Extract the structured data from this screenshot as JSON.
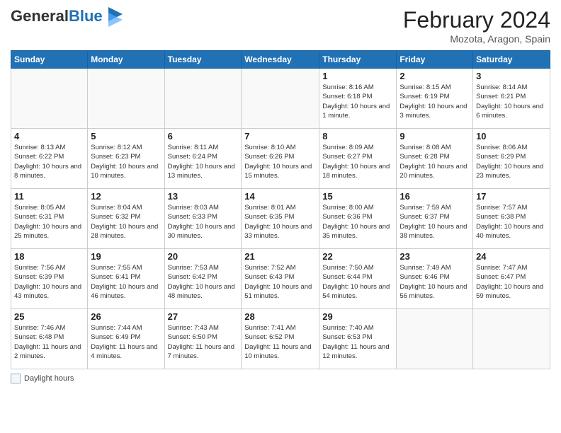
{
  "header": {
    "logo_general": "General",
    "logo_blue": "Blue",
    "month_title": "February 2024",
    "location": "Mozota, Aragon, Spain"
  },
  "days_of_week": [
    "Sunday",
    "Monday",
    "Tuesday",
    "Wednesday",
    "Thursday",
    "Friday",
    "Saturday"
  ],
  "weeks": [
    [
      {
        "day": "",
        "info": ""
      },
      {
        "day": "",
        "info": ""
      },
      {
        "day": "",
        "info": ""
      },
      {
        "day": "",
        "info": ""
      },
      {
        "day": "1",
        "info": "Sunrise: 8:16 AM\nSunset: 6:18 PM\nDaylight: 10 hours and 1 minute."
      },
      {
        "day": "2",
        "info": "Sunrise: 8:15 AM\nSunset: 6:19 PM\nDaylight: 10 hours and 3 minutes."
      },
      {
        "day": "3",
        "info": "Sunrise: 8:14 AM\nSunset: 6:21 PM\nDaylight: 10 hours and 6 minutes."
      }
    ],
    [
      {
        "day": "4",
        "info": "Sunrise: 8:13 AM\nSunset: 6:22 PM\nDaylight: 10 hours and 8 minutes."
      },
      {
        "day": "5",
        "info": "Sunrise: 8:12 AM\nSunset: 6:23 PM\nDaylight: 10 hours and 10 minutes."
      },
      {
        "day": "6",
        "info": "Sunrise: 8:11 AM\nSunset: 6:24 PM\nDaylight: 10 hours and 13 minutes."
      },
      {
        "day": "7",
        "info": "Sunrise: 8:10 AM\nSunset: 6:26 PM\nDaylight: 10 hours and 15 minutes."
      },
      {
        "day": "8",
        "info": "Sunrise: 8:09 AM\nSunset: 6:27 PM\nDaylight: 10 hours and 18 minutes."
      },
      {
        "day": "9",
        "info": "Sunrise: 8:08 AM\nSunset: 6:28 PM\nDaylight: 10 hours and 20 minutes."
      },
      {
        "day": "10",
        "info": "Sunrise: 8:06 AM\nSunset: 6:29 PM\nDaylight: 10 hours and 23 minutes."
      }
    ],
    [
      {
        "day": "11",
        "info": "Sunrise: 8:05 AM\nSunset: 6:31 PM\nDaylight: 10 hours and 25 minutes."
      },
      {
        "day": "12",
        "info": "Sunrise: 8:04 AM\nSunset: 6:32 PM\nDaylight: 10 hours and 28 minutes."
      },
      {
        "day": "13",
        "info": "Sunrise: 8:03 AM\nSunset: 6:33 PM\nDaylight: 10 hours and 30 minutes."
      },
      {
        "day": "14",
        "info": "Sunrise: 8:01 AM\nSunset: 6:35 PM\nDaylight: 10 hours and 33 minutes."
      },
      {
        "day": "15",
        "info": "Sunrise: 8:00 AM\nSunset: 6:36 PM\nDaylight: 10 hours and 35 minutes."
      },
      {
        "day": "16",
        "info": "Sunrise: 7:59 AM\nSunset: 6:37 PM\nDaylight: 10 hours and 38 minutes."
      },
      {
        "day": "17",
        "info": "Sunrise: 7:57 AM\nSunset: 6:38 PM\nDaylight: 10 hours and 40 minutes."
      }
    ],
    [
      {
        "day": "18",
        "info": "Sunrise: 7:56 AM\nSunset: 6:39 PM\nDaylight: 10 hours and 43 minutes."
      },
      {
        "day": "19",
        "info": "Sunrise: 7:55 AM\nSunset: 6:41 PM\nDaylight: 10 hours and 46 minutes."
      },
      {
        "day": "20",
        "info": "Sunrise: 7:53 AM\nSunset: 6:42 PM\nDaylight: 10 hours and 48 minutes."
      },
      {
        "day": "21",
        "info": "Sunrise: 7:52 AM\nSunset: 6:43 PM\nDaylight: 10 hours and 51 minutes."
      },
      {
        "day": "22",
        "info": "Sunrise: 7:50 AM\nSunset: 6:44 PM\nDaylight: 10 hours and 54 minutes."
      },
      {
        "day": "23",
        "info": "Sunrise: 7:49 AM\nSunset: 6:46 PM\nDaylight: 10 hours and 56 minutes."
      },
      {
        "day": "24",
        "info": "Sunrise: 7:47 AM\nSunset: 6:47 PM\nDaylight: 10 hours and 59 minutes."
      }
    ],
    [
      {
        "day": "25",
        "info": "Sunrise: 7:46 AM\nSunset: 6:48 PM\nDaylight: 11 hours and 2 minutes."
      },
      {
        "day": "26",
        "info": "Sunrise: 7:44 AM\nSunset: 6:49 PM\nDaylight: 11 hours and 4 minutes."
      },
      {
        "day": "27",
        "info": "Sunrise: 7:43 AM\nSunset: 6:50 PM\nDaylight: 11 hours and 7 minutes."
      },
      {
        "day": "28",
        "info": "Sunrise: 7:41 AM\nSunset: 6:52 PM\nDaylight: 11 hours and 10 minutes."
      },
      {
        "day": "29",
        "info": "Sunrise: 7:40 AM\nSunset: 6:53 PM\nDaylight: 11 hours and 12 minutes."
      },
      {
        "day": "",
        "info": ""
      },
      {
        "day": "",
        "info": ""
      }
    ]
  ],
  "legend": {
    "label": "Daylight hours"
  }
}
